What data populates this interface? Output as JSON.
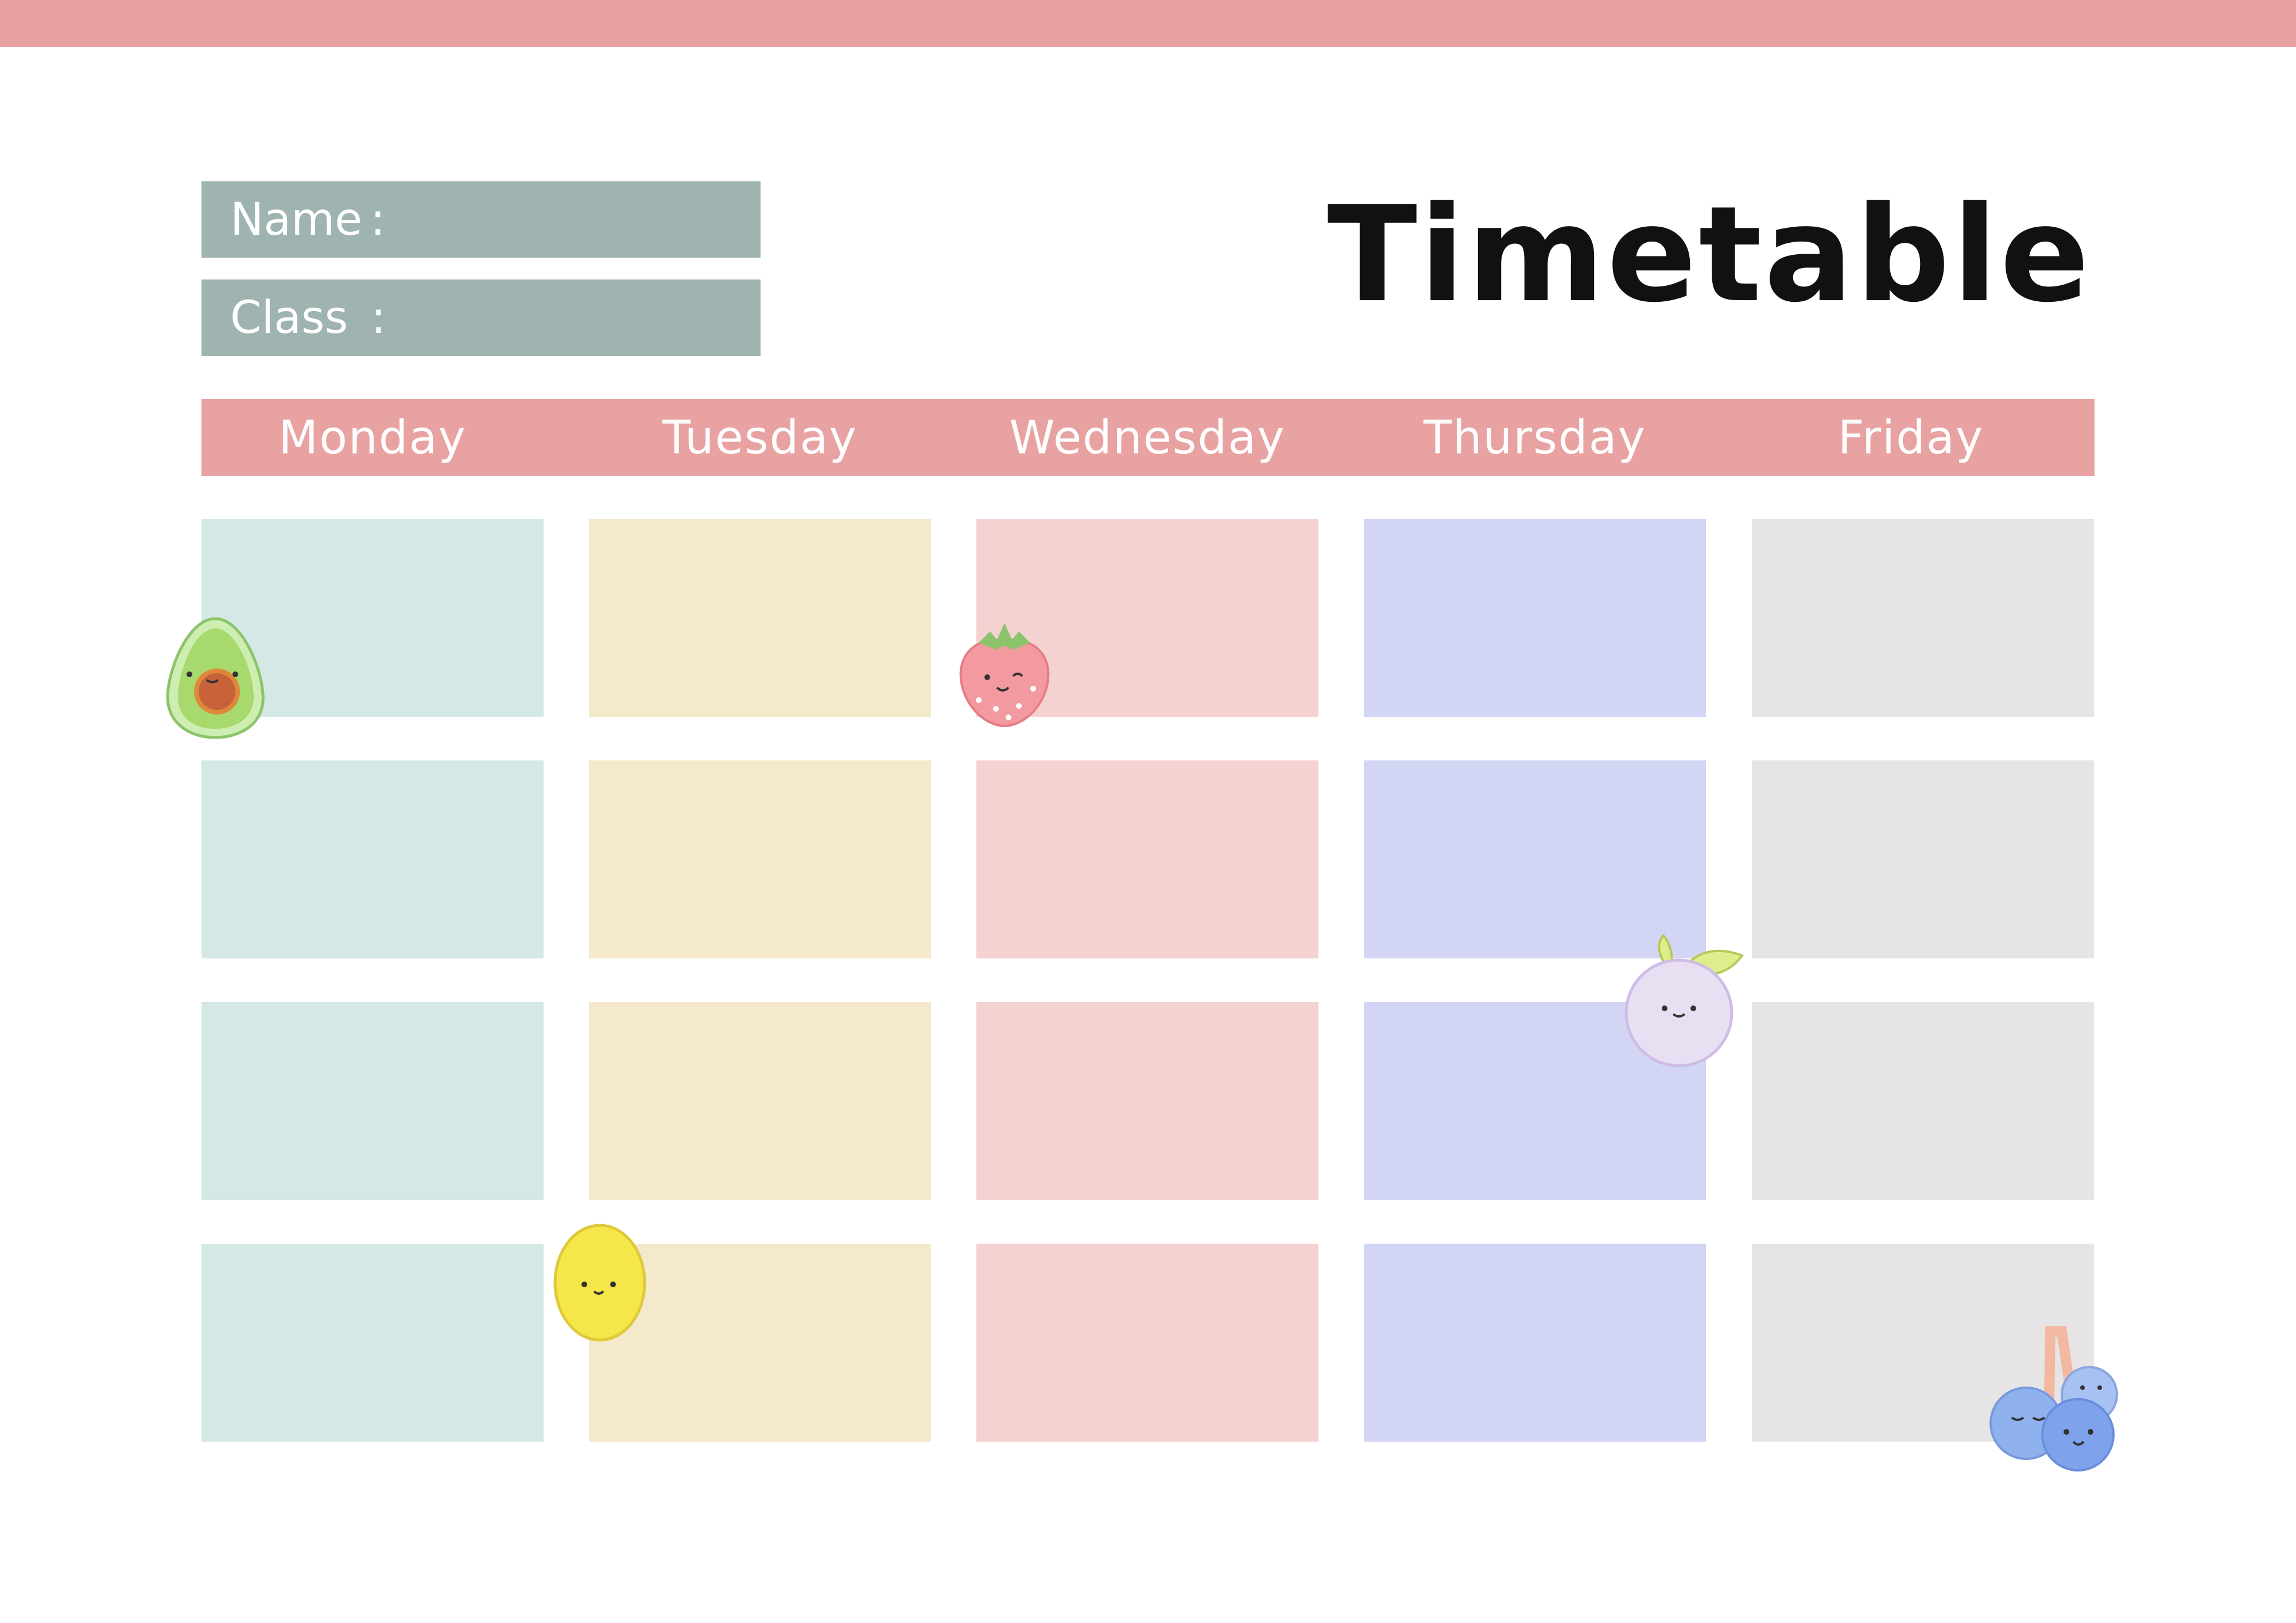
{
  "header": {
    "name_label": "Name",
    "class_label": "Class",
    "colon": ":",
    "title": "Timetable"
  },
  "days": [
    "Monday",
    "Tuesday",
    "Wednesday",
    "Thursday",
    "Friday"
  ],
  "colors": {
    "top_bar": "#e8a2a2",
    "header_bar": "#e8a2a2",
    "fields": "#9fb3b0",
    "column_colors": [
      "#d4e8e6",
      "#f4eacb",
      "#f5d2d2",
      "#d2d5f4",
      "#e6e4e4"
    ]
  },
  "grid": {
    "rows": 4,
    "columns": 5
  },
  "stickers": [
    "avocado-icon",
    "strawberry-icon",
    "grape-icon",
    "lemon-icon",
    "blueberries-icon"
  ]
}
